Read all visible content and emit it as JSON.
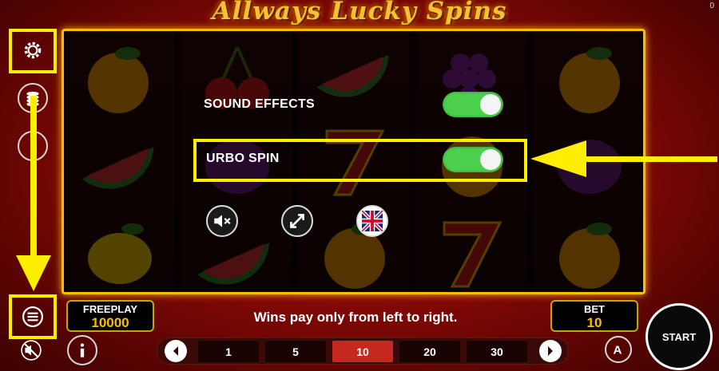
{
  "game": {
    "title": "Allways Lucky Spins",
    "corner_counter": "0"
  },
  "settings": {
    "sound_effects_label": "SOUND EFFECTS",
    "sound_effects_on": true,
    "turbo_spin_label": "URBO SPIN",
    "turbo_spin_on": true,
    "icons": [
      "sound-muted-icon",
      "fullscreen-icon",
      "uk-flag-icon"
    ]
  },
  "side_menu": {
    "icons": [
      "gear-icon",
      "coin-stack-icon",
      "empty-circle-icon",
      "hamburger-menu-icon",
      "sound-muted-icon",
      "info-icon"
    ]
  },
  "bottom": {
    "freeplay_label": "FREEPLAY",
    "freeplay_value": "10000",
    "wins_text": "Wins pay only from left to right.",
    "bet_label": "BET",
    "bet_value": "10",
    "bet_options": [
      "1",
      "5",
      "10",
      "20",
      "30"
    ],
    "selected_bet": "10",
    "start_label": "START"
  },
  "reels": [
    [
      "orange",
      "watermelon",
      "lemon"
    ],
    [
      "cherry",
      "plum",
      "watermelon"
    ],
    [
      "watermelon",
      "seven",
      "orange"
    ],
    [
      "grapes",
      "orange",
      "seven"
    ],
    [
      "orange",
      "plum",
      "orange"
    ]
  ],
  "colors": {
    "highlight": "#ffee00",
    "toggle_on": "#4ccf4c",
    "frame_gold": "#f6c000",
    "active_bet": "#c5281e"
  }
}
